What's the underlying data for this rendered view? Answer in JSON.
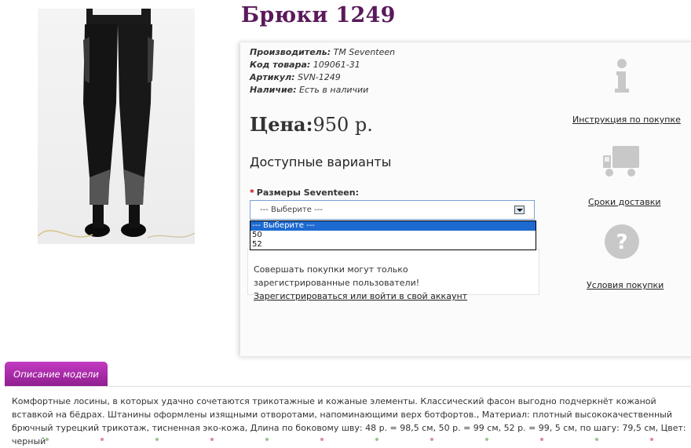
{
  "product": {
    "title": "Брюки 1249",
    "image_alt": "Брюки 1249"
  },
  "specs": [
    {
      "label": "Производитель:",
      "value": "TM Seventeen"
    },
    {
      "label": "Код товара:",
      "value": "109061-31"
    },
    {
      "label": "Артикул:",
      "value": "SVN-1249"
    },
    {
      "label": "Наличие:",
      "value": "Есть в наличии"
    }
  ],
  "price": {
    "label": "Цена:",
    "value": "950 р."
  },
  "variants": {
    "title": "Доступные варианты",
    "required_mark": "*",
    "size_label": "Размеры Seventeen:",
    "selected": "--- Выберите ---",
    "options": [
      "--- Выберите ---",
      "50",
      "52"
    ]
  },
  "notice": {
    "text": "Совершать покупки могут только зарегистрированные пользователи!",
    "link": "Зарегистрироваться или войти в свой аккаунт"
  },
  "side_links": [
    {
      "icon": "info-icon",
      "label": "Инструкция по покупке"
    },
    {
      "icon": "truck-icon",
      "label": "Сроки доставки"
    },
    {
      "icon": "question-icon",
      "label": "Условия покупки"
    }
  ],
  "description": {
    "tab_label": "Описание модели",
    "text": "Комфортные лосины, в которых удачно сочетаются трикотажные и кожаные элементы. Классический фасон выгодно подчеркнёт кожаной вставкой на бёдрах. Штанины оформлены изящными отворотами, напоминающими верх ботфортов., Материал: плотный высококачественный брючный турецкий трикотаж, тисненная эко-кожа, Длина по боковому шву: 48 р. = 98,5 см, 50 р. = 99 см, 52 р. = 99, 5 см, по шагу: 79,5 см, Цвет: черный"
  },
  "colors": {
    "title": "#5a1a5a",
    "tab": "#a82ba8",
    "select_border": "#7aa3d6",
    "dropdown_highlight": "#1e6ad0",
    "icon_gray": "#c8c8c8"
  }
}
